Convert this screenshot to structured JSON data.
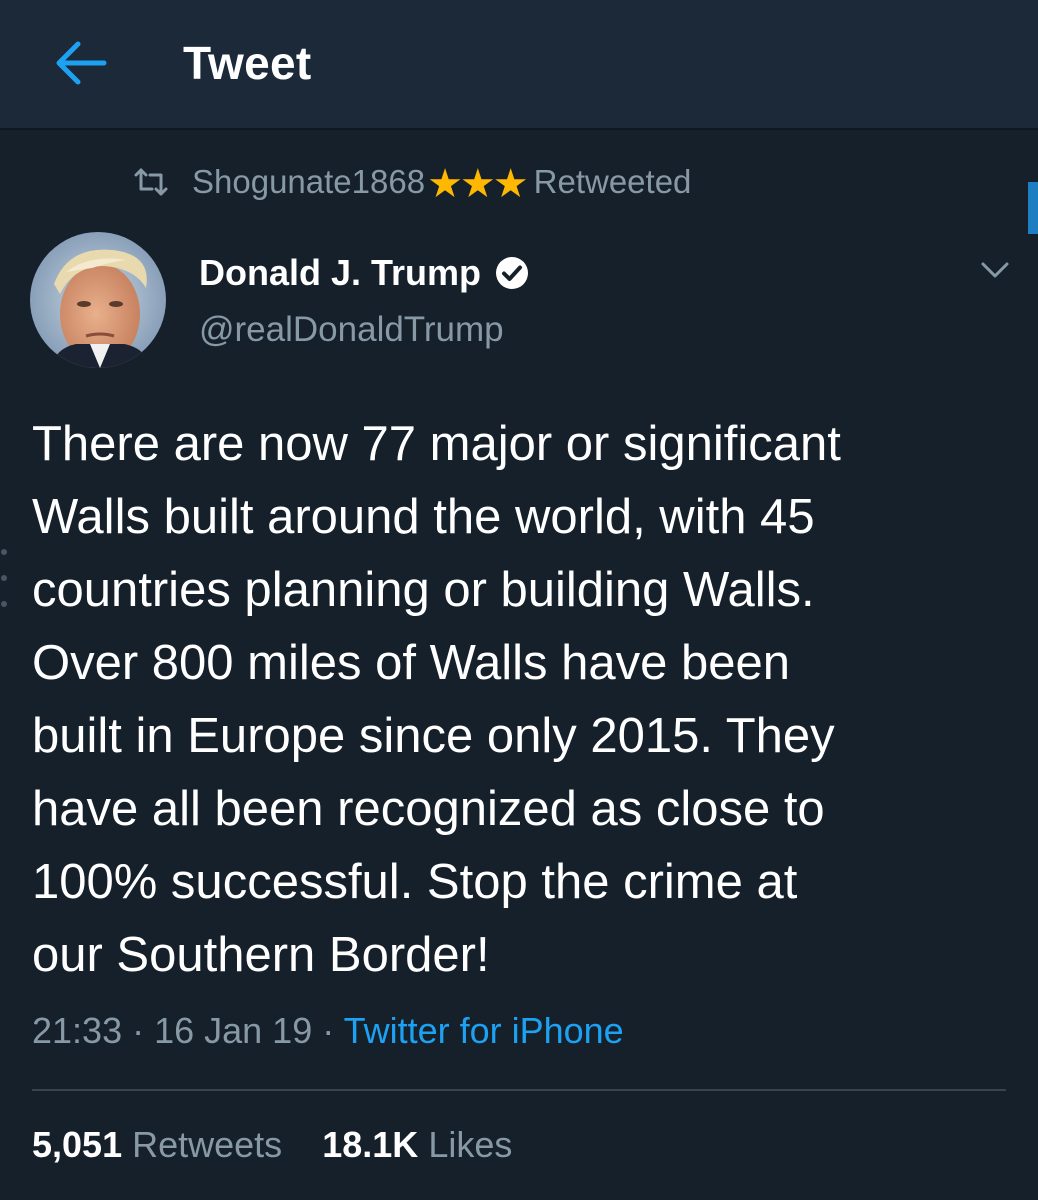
{
  "header": {
    "title": "Tweet"
  },
  "retweet_context": {
    "username": "Shogunate1868",
    "stars": "★★★",
    "action": "Retweeted"
  },
  "author": {
    "name": "Donald J. Trump",
    "handle": "@realDonaldTrump",
    "verified": true
  },
  "tweet": {
    "lines": [
      "There are now 77 major or significant",
      "Walls built around the world, with 45",
      "countries planning or building Walls.",
      "Over 800 miles of Walls have been",
      "built in Europe since only 2015. They",
      "have all been recognized as close to",
      "100% successful. Stop the crime at",
      "our Southern Border!"
    ],
    "time": "21:33",
    "separator": " · ",
    "date": "16 Jan 19",
    "source": "Twitter for iPhone"
  },
  "stats": {
    "retweets_count": "5,051",
    "retweets_label": "Retweets",
    "likes_count": "18.1K",
    "likes_label": "Likes"
  },
  "colors": {
    "background": "#15202b",
    "header_background": "#1c2938",
    "accent": "#1da1f2",
    "secondary_text": "#8899a6",
    "star": "#ffb800"
  },
  "icons": {
    "back": "arrow-left-icon",
    "retweet": "retweet-icon",
    "verified": "verified-badge-icon",
    "more": "chevron-down-icon"
  }
}
